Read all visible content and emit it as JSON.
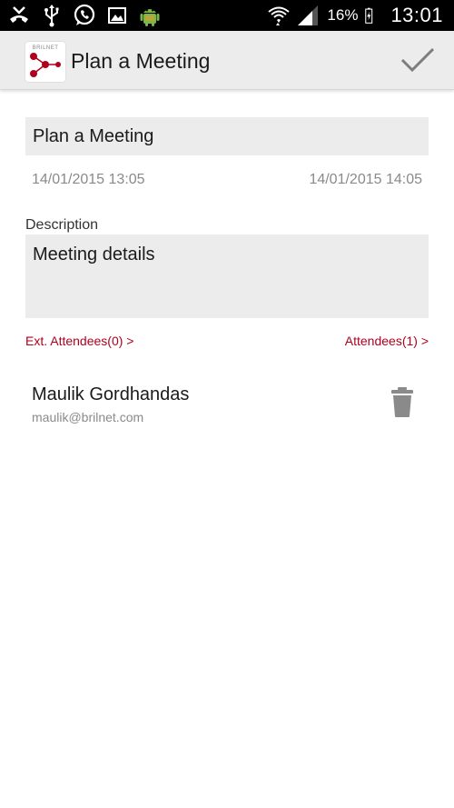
{
  "status_bar": {
    "icons": [
      "missed-call-icon",
      "usb-icon",
      "whatsapp-icon",
      "image-icon",
      "android-icon"
    ],
    "right_icons": [
      "wifi-icon",
      "signal-icon",
      "battery-icon"
    ],
    "battery_percent": "16%",
    "time": "13:01"
  },
  "action_bar": {
    "title": "Plan a Meeting",
    "logo_text": "BRILNET",
    "done_icon": "check-icon"
  },
  "form": {
    "title_value": "Plan a Meeting",
    "start_datetime": "14/01/2015 13:05",
    "end_datetime": "14/01/2015 14:05",
    "description_label": "Description",
    "description_value": "Meeting details",
    "ext_attendees_link": "Ext. Attendees(0) >",
    "attendees_link": "Attendees(1) >"
  },
  "attendees": [
    {
      "name": "Maulik Gordhandas",
      "email": "maulik@brilnet.com",
      "action_icon": "trash-icon"
    }
  ],
  "colors": {
    "accent": "#b0001e",
    "action_bar_bg": "#ececec",
    "input_bg": "#ececec",
    "muted_text": "#8a8a8a"
  }
}
